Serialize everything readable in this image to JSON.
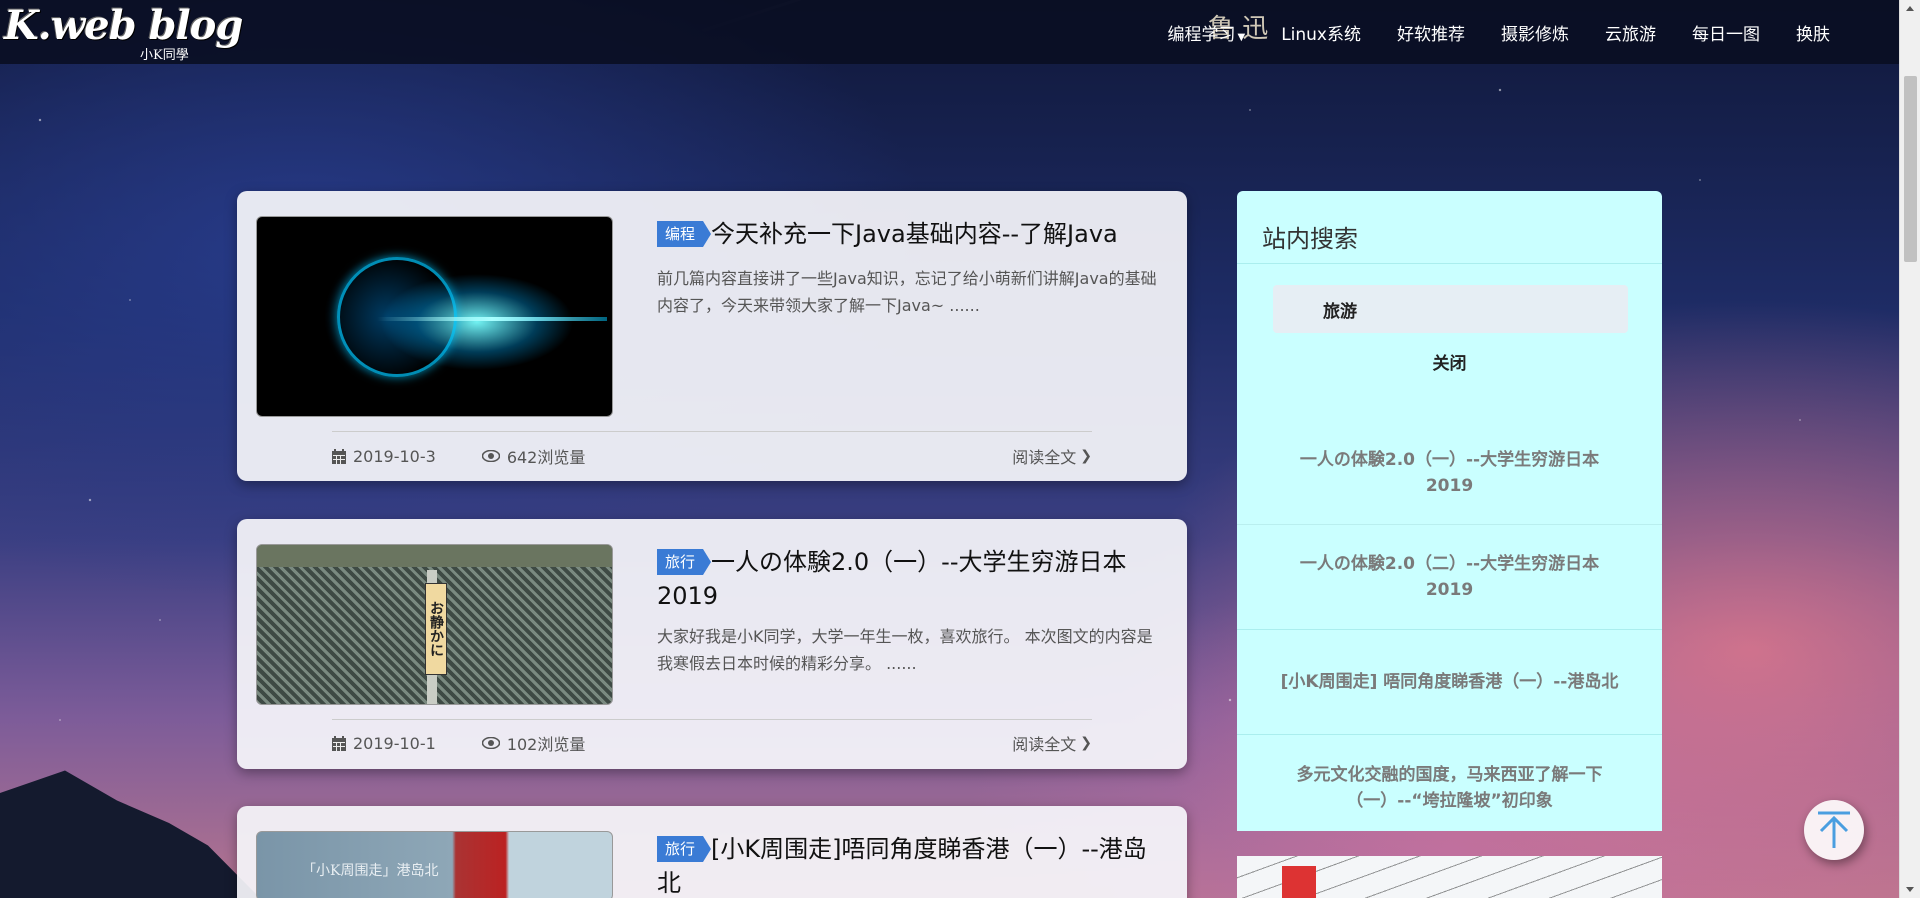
{
  "header": {
    "logo": "K.web blog",
    "logo_sub": "小K同學",
    "nav_overlay": "鲁 迅",
    "nav": [
      {
        "label": "编程学习",
        "has_dropdown": true
      },
      {
        "label": "Linux系统"
      },
      {
        "label": "好软推荐"
      },
      {
        "label": "摄影修炼"
      },
      {
        "label": "云旅游"
      },
      {
        "label": "每日一图"
      },
      {
        "label": "换肤"
      }
    ]
  },
  "posts": [
    {
      "tag": "编程",
      "title": "今天补充一下Java基础内容--了解Java",
      "excerpt": "前几篇内容直接讲了一些Java知识，忘记了给小萌新们讲解Java的基础内容了，今天来带领大家了解一下Java~ ......",
      "date": "2019-10-3",
      "views": "642浏览量",
      "read_more": "阅读全文"
    },
    {
      "tag": "旅行",
      "title": "一人の体験2.0（一）--大学生穷游日本2019",
      "excerpt": "大家好我是小K同学，大学一年生一枚，喜欢旅行。 本次图文的内容是我寒假去日本时候的精彩分享。 ......",
      "date": "2019-10-1",
      "views": "102浏览量",
      "read_more": "阅读全文",
      "thumb_sign": "お静かに"
    },
    {
      "tag": "旅行",
      "title": "[小K周围走]唔同角度睇香港（一）--港岛北",
      "thumb_caption": "「小K周围走」港岛北"
    }
  ],
  "sidebar": {
    "title": "站内搜索",
    "search_value": "旅游",
    "close_label": "关闭",
    "results": [
      "一人の体験2.0（一）--大学生穷游日本2019",
      "一人の体験2.0（二）--大学生穷游日本2019",
      "[小K周围走] 唔同角度睇香港（一）--港岛北",
      "多元文化交融的国度，马来西亚了解一下（一）--“垮拉隆坡”初印象"
    ]
  },
  "colors": {
    "tag_bg": "#3a7bd5",
    "sidebar_bg": "#caffff",
    "to_top_arrow": "#4a9ee0"
  },
  "icons": {
    "date": "calendar-icon",
    "views": "eye-icon",
    "read_more": "chevron-right-icon",
    "to_top": "arrow-up-icon"
  }
}
